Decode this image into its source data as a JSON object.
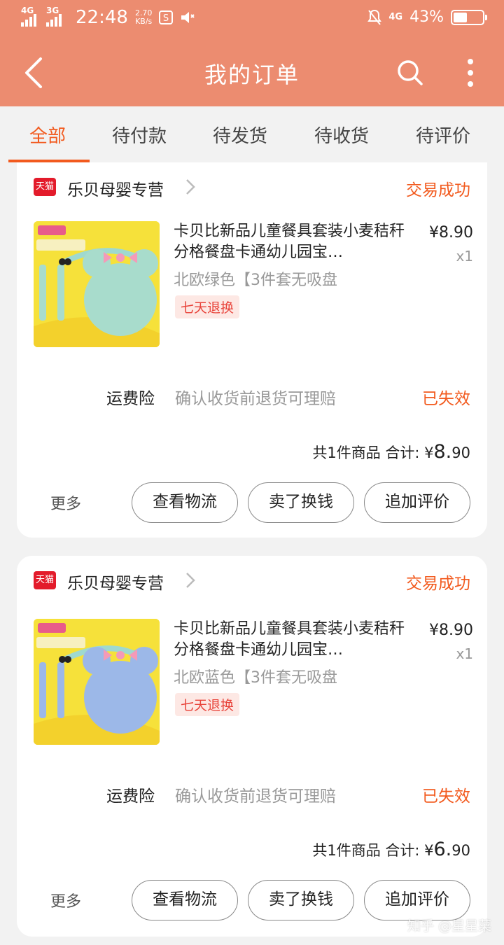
{
  "statusbar": {
    "net1": "4G",
    "net2": "3G",
    "time": "22:48",
    "speed_value": "2.70",
    "speed_unit": "KB/s",
    "net3": "4G",
    "battery_percent": "43%"
  },
  "header": {
    "title": "我的订单"
  },
  "tabs": [
    "全部",
    "待付款",
    "待发货",
    "待收货",
    "待评价"
  ],
  "active_tab": 0,
  "orders": [
    {
      "shop_badge": "天猫",
      "shop_name": "乐贝母婴专营",
      "status": "交易成功",
      "item_title": "卡贝比新品儿童餐具套装小麦秸秆分格餐盘卡通幼儿园宝…",
      "sku": "北欧绿色【3件套无吸盘",
      "tag": "七天退换",
      "price": "¥8.90",
      "qty": "x1",
      "thumb_color": "#a8dccc",
      "insurance_label": "运费险",
      "insurance_desc": "确认收货前退货可理赔",
      "insurance_status": "已失效",
      "total_label": "共1件商品  合计: ¥",
      "total_int": "8.",
      "total_dec": "90",
      "more": "更多",
      "buttons": [
        "查看物流",
        "卖了换钱",
        "追加评价"
      ]
    },
    {
      "shop_badge": "天猫",
      "shop_name": "乐贝母婴专营",
      "status": "交易成功",
      "item_title": "卡贝比新品儿童餐具套装小麦秸秆分格餐盘卡通幼儿园宝…",
      "sku": "北欧蓝色【3件套无吸盘",
      "tag": "七天退换",
      "price": "¥8.90",
      "qty": "x1",
      "thumb_color": "#9cb8e8",
      "insurance_label": "运费险",
      "insurance_desc": "确认收货前退货可理赔",
      "insurance_status": "已失效",
      "total_label": "共1件商品  合计: ¥",
      "total_int": "6.",
      "total_dec": "90",
      "more": "更多",
      "buttons": [
        "查看物流",
        "卖了换钱",
        "追加评价"
      ]
    }
  ],
  "watermark": "知乎 @星星菜",
  "colors": {
    "header": "#ec8c70",
    "accent": "#f25a1e",
    "tmall": "#e31b2b"
  }
}
